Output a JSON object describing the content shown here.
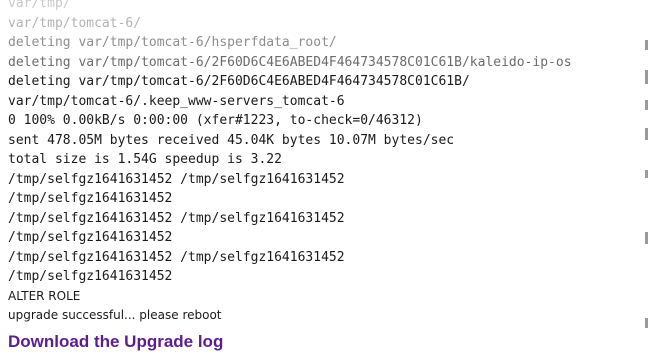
{
  "log": {
    "lines": [
      "var/tmp/",
      "var/tmp/tomcat-6/",
      "deleting var/tmp/tomcat-6/hsperfdata_root/",
      "deleting var/tmp/tomcat-6/2F60D6C4E6ABED4F464734578C01C61B/kaleido-ip-os",
      "deleting var/tmp/tomcat-6/2F60D6C4E6ABED4F464734578C01C61B/",
      "var/tmp/tomcat-6/.keep_www-servers_tomcat-6",
      "0 100% 0.00kB/s 0:00:00 (xfer#1223, to-check=0/46312)",
      "sent 478.05M bytes received 45.04K bytes 10.07M bytes/sec",
      "total size is 1.54G speedup is 3.22",
      "/tmp/selfgz1641631452 /tmp/selfgz1641631452",
      "/tmp/selfgz1641631452",
      "/tmp/selfgz1641631452 /tmp/selfgz1641631452",
      "/tmp/selfgz1641631452",
      "/tmp/selfgz1641631452 /tmp/selfgz1641631452",
      "/tmp/selfgz1641631452",
      "ALTER ROLE",
      "upgrade successful... please reboot"
    ]
  },
  "download_link": {
    "label": "Download the Upgrade log"
  }
}
